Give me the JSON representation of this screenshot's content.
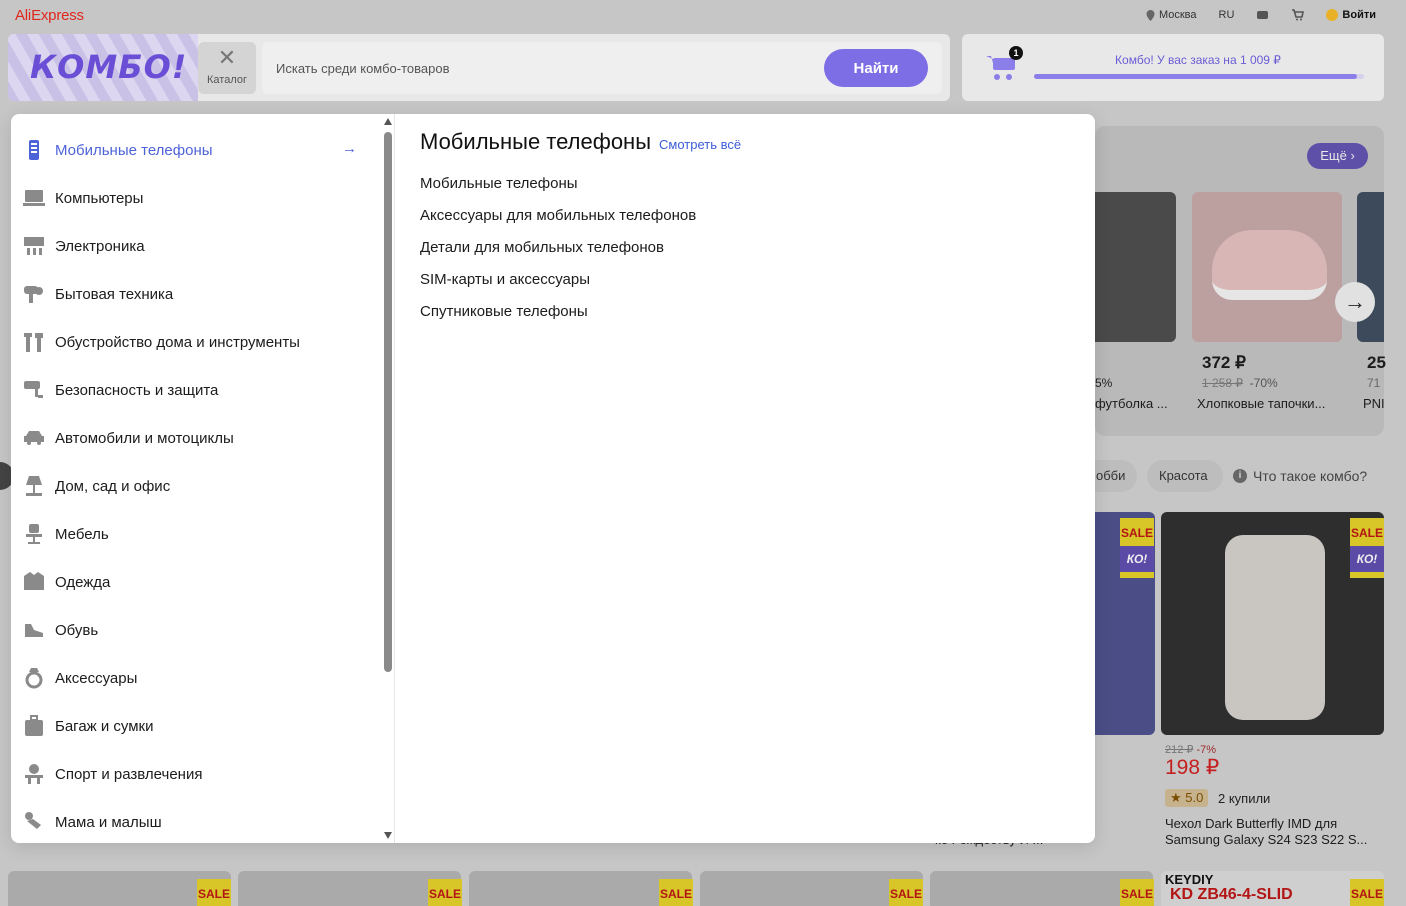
{
  "brand": {
    "logo": "AliExpress"
  },
  "topnav": {
    "city": "Москва",
    "lang": "RU",
    "login": "Войти"
  },
  "combo": {
    "logo": "КОМБО!",
    "catalog_label": "Каталог",
    "search_placeholder": "Искать среди комбо-товаров",
    "search_button": "Найти",
    "order_text": "Комбо! У вас заказ на 1 009 ₽",
    "cart_count": "1",
    "order_progress": 0.98
  },
  "catalog": {
    "categories": [
      {
        "label": "Мобильные телефоны",
        "icon": "phone-icon"
      },
      {
        "label": "Компьютеры",
        "icon": "computer-icon"
      },
      {
        "label": "Электроника",
        "icon": "electronics-icon"
      },
      {
        "label": "Бытовая техника",
        "icon": "appliance-icon"
      },
      {
        "label": "Обустройство дома и инструменты",
        "icon": "tools-icon"
      },
      {
        "label": "Безопасность и защита",
        "icon": "camera-icon"
      },
      {
        "label": "Автомобили и мотоциклы",
        "icon": "car-icon"
      },
      {
        "label": "Дом, сад и офис",
        "icon": "lamp-icon"
      },
      {
        "label": "Мебель",
        "icon": "chair-icon"
      },
      {
        "label": "Одежда",
        "icon": "jacket-icon"
      },
      {
        "label": "Обувь",
        "icon": "shoe-icon"
      },
      {
        "label": "Аксессуары",
        "icon": "ring-icon"
      },
      {
        "label": "Багаж и сумки",
        "icon": "luggage-icon"
      },
      {
        "label": "Спорт и развлечения",
        "icon": "sport-icon"
      },
      {
        "label": "Мама и малыш",
        "icon": "baby-icon"
      }
    ],
    "active_title": "Мобильные телефоны",
    "see_all": "Смотреть всё",
    "subcategories": [
      "Мобильные телефоны",
      "Аксессуары для мобильных телефонов",
      "Детали для мобильных телефонов",
      "SIM-карты и аксессуары",
      "Спутниковые телефоны"
    ]
  },
  "background": {
    "more_button": "Ещё",
    "card_a": {
      "discount": "5%",
      "title": "футболка ..."
    },
    "card_b": {
      "price": "372 ₽",
      "old_price": "1 258 ₽",
      "discount": "-70%",
      "title": "Хлопковые тапочки..."
    },
    "card_c": {
      "price": "25",
      "old_price": "71",
      "title": "PNI"
    },
    "chips": [
      "обби",
      "Красота"
    ],
    "what_is": "Что такое комбо?",
    "sale": "SALE",
    "combo_tag": "КО!",
    "product": {
      "old_price": "212 ₽",
      "discount": "-7%",
      "price": "198 ₽",
      "rating": "★ 5.0",
      "bought": "2 купили",
      "title": "Чехол Dark Butterfly IMD для Samsung Galaxy S24 S23 S22 S..."
    },
    "bottom_text": "ко Рождеству И ...",
    "keydiy": "KEYDIY",
    "keydiy_sub": "KD ZB46-4-SLID"
  }
}
